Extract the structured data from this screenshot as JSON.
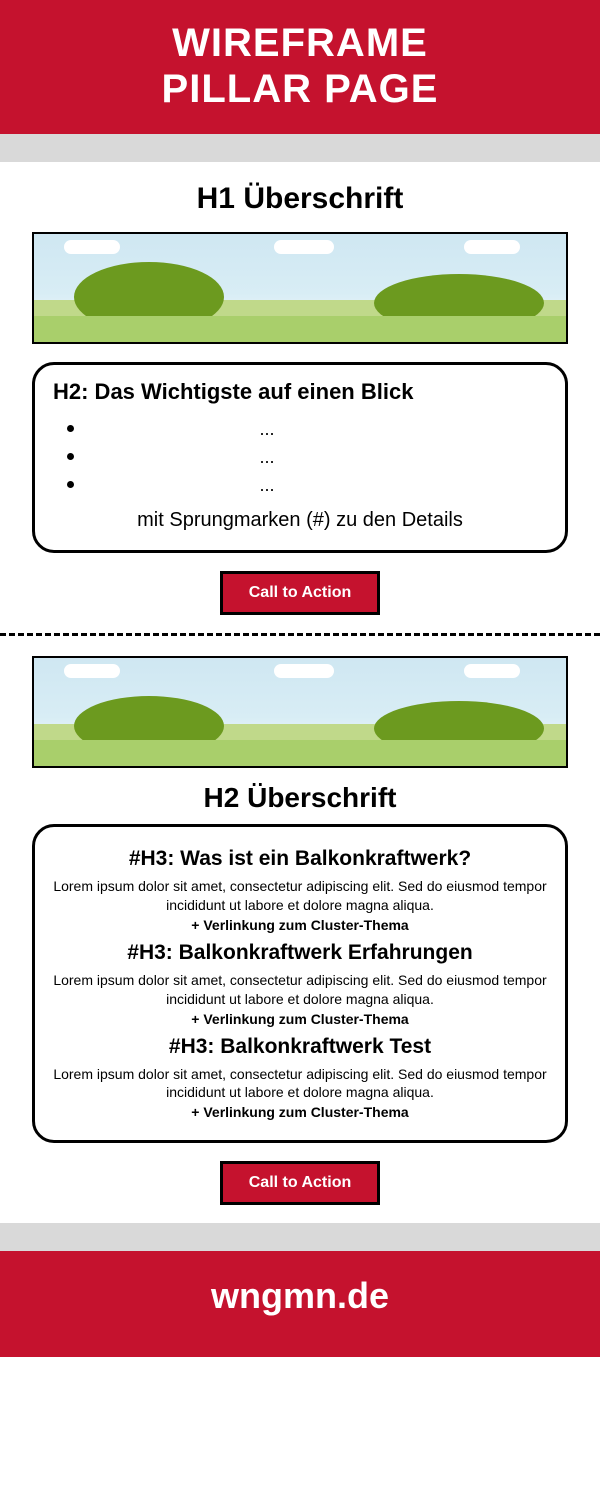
{
  "header": {
    "line1": "WIREFRAME",
    "line2": "PILLAR PAGE"
  },
  "section1": {
    "h1": "H1 Überschrift",
    "box": {
      "h2": "H2: Das Wichtigste auf einen Blick",
      "bullets": [
        "...",
        "...",
        "..."
      ],
      "note": "mit Sprungmarken (#) zu den Details"
    },
    "cta": "Call to Action"
  },
  "section2": {
    "h2": "H2 Überschrift",
    "items": [
      {
        "h3": "#H3: Was ist ein Balkonkraftwerk?",
        "text": "Lorem ipsum dolor sit amet, consectetur adipiscing elit. Sed do eiusmod tempor incididunt ut labore et dolore magna aliqua.",
        "link": "+ Verlinkung zum Cluster-Thema"
      },
      {
        "h3": "#H3: Balkonkraftwerk Erfahrungen",
        "text": "Lorem ipsum dolor sit amet, consectetur adipiscing elit. Sed do eiusmod tempor incididunt ut labore et dolore magna aliqua.",
        "link": "+ Verlinkung zum Cluster-Thema"
      },
      {
        "h3": "#H3: Balkonkraftwerk Test",
        "text": "Lorem ipsum dolor sit amet, consectetur adipiscing elit. Sed do eiusmod tempor incididunt ut labore et dolore magna aliqua.",
        "link": "+ Verlinkung zum Cluster-Thema"
      }
    ],
    "cta": "Call to Action"
  },
  "footer": {
    "text": "wngmn.de"
  }
}
